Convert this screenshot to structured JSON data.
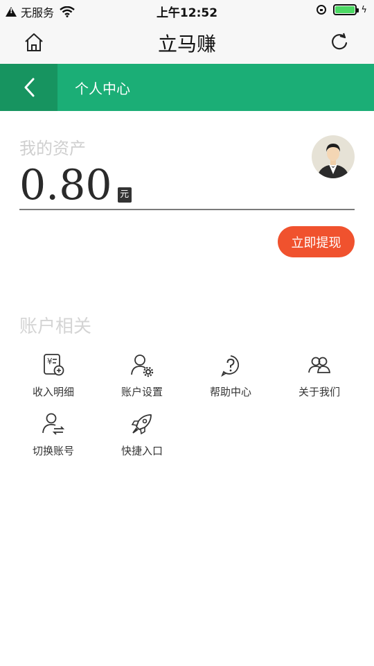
{
  "status_bar": {
    "carrier": "无服务",
    "time": "上午12:52"
  },
  "title_bar": {
    "title": "立马赚"
  },
  "nav": {
    "title": "个人中心"
  },
  "assets": {
    "label": "我的资产",
    "amount": "0.80",
    "unit": "元"
  },
  "withdraw_button": "立即提现",
  "account_section": {
    "title": "账户相关",
    "items": [
      {
        "label": "收入明细",
        "icon": "income-detail-icon"
      },
      {
        "label": "账户设置",
        "icon": "account-settings-icon"
      },
      {
        "label": "帮助中心",
        "icon": "help-icon"
      },
      {
        "label": "关于我们",
        "icon": "about-us-icon"
      },
      {
        "label": "切换账号",
        "icon": "switch-account-icon"
      },
      {
        "label": "快捷入口",
        "icon": "rocket-icon"
      }
    ]
  },
  "colors": {
    "green": "#1bae76",
    "green_dark": "#179460",
    "withdraw": "#f0522e"
  }
}
